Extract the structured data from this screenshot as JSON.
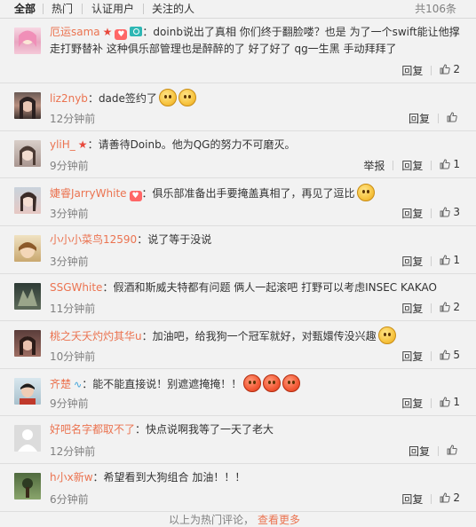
{
  "tabs": [
    "全部",
    "热门",
    "认证用户",
    "关注的人"
  ],
  "total_label": "共106条",
  "actions": {
    "reply": "回复",
    "report": "举报"
  },
  "comments": [
    {
      "user": "厄运sama",
      "text": "：doinb说出了真相 你们终于翻脸喽？也是 为了一个swift能让他撑走打野替补 这种俱乐部管理也是醉醉的了 好了好了 qg一生黑 手动拜拜了",
      "time": "",
      "likes": "2"
    },
    {
      "user": "liz2nyb",
      "text": "：dade签约了",
      "time": "12分钟前",
      "likes": ""
    },
    {
      "user": "yliH_",
      "text": "：请善待Doinb。他为QG的努力不可磨灭。",
      "time": "9分钟前",
      "likes": "1"
    },
    {
      "user": "婕睿JarryWhite",
      "text": "：俱乐部准备出手要掩盖真相了，再见了逗比",
      "time": "3分钟前",
      "likes": "3"
    },
    {
      "user": "小小小菜鸟12590",
      "text": "：说了等于没说",
      "time": "3分钟前",
      "likes": "1"
    },
    {
      "user": "SSGWhite",
      "text": "：假酒和斯威夫特都有问题 俩人一起滚吧 打野可以考虑INSEC KAKAO",
      "time": "11分钟前",
      "likes": "2"
    },
    {
      "user": "桃之夭夭灼灼其华u",
      "text": "：加油吧，给我狗一个冠军就好，对甄嬛传没兴趣",
      "time": "10分钟前",
      "likes": "5"
    },
    {
      "user": "齐楚",
      "text": "：能不能直接说！别遮遮掩掩！！",
      "time": "9分钟前",
      "likes": "1"
    },
    {
      "user": "好吧名字都取不了",
      "text": "：快点说啊我等了一天了老大",
      "time": "12分钟前",
      "likes": ""
    },
    {
      "user": "h小x新w",
      "text": "：希望看到大狗组合  加油！！！",
      "time": "6分钟前",
      "likes": "2"
    }
  ],
  "more": {
    "prefix": "以上为热门评论，",
    "link": "查看更多"
  },
  "colors": {
    "username": "#eb7350",
    "time": "#808080",
    "background": "#f2f2f2"
  }
}
